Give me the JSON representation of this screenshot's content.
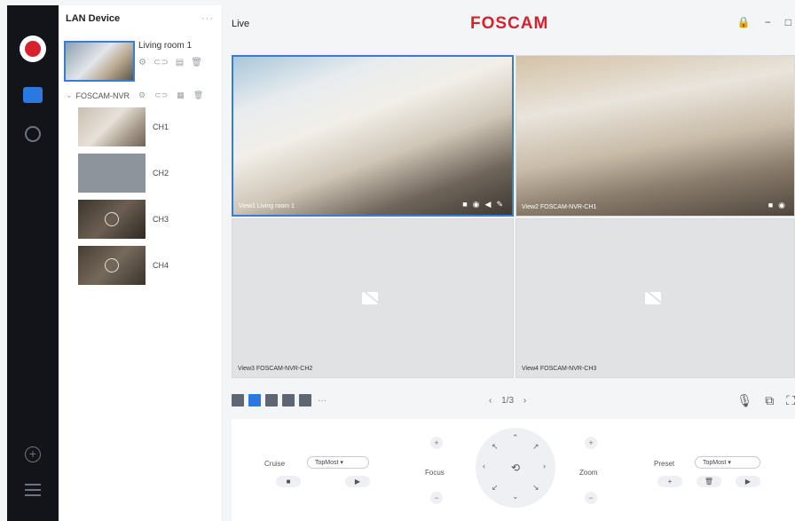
{
  "brand": {
    "name": "FOSCAM",
    "accent": "#d8212d",
    "selected": "#2a78e0"
  },
  "device_panel": {
    "title": "LAN Device",
    "more_label": "···",
    "camera": {
      "name": "Living room 1"
    },
    "nvr": {
      "name": "FOSCAM-NVR",
      "channels": [
        {
          "label": "CH1"
        },
        {
          "label": "CH2"
        },
        {
          "label": "CH3"
        },
        {
          "label": "CH4"
        }
      ]
    }
  },
  "header": {
    "live_label": "Live"
  },
  "views": [
    {
      "caption": "View1 Living room 1"
    },
    {
      "caption": "View2 FOSCAM-NVR-CH1"
    },
    {
      "caption": "View3 FOSCAM-NVR-CH2"
    },
    {
      "caption": "View4 FOSCAM-NVR-CH3"
    }
  ],
  "toolbar": {
    "page": "1/3",
    "more_label": "···"
  },
  "ptz": {
    "cruise_label": "Cruise",
    "cruise_value": "TopMost",
    "focus_label": "Focus",
    "zoom_label": "Zoom",
    "preset_label": "Preset",
    "preset_value": "TopMost"
  }
}
